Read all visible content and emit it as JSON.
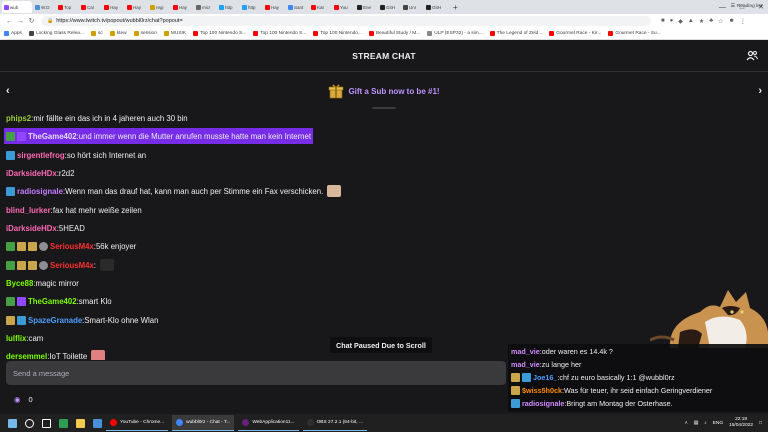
{
  "browser": {
    "tabs": [
      {
        "label": "wub",
        "color": "#9147ff",
        "active": true
      },
      {
        "label": "W.D",
        "color": "#4a90d9"
      },
      {
        "label": "Top",
        "color": "#ff0000"
      },
      {
        "label": "Cal",
        "color": "#ff0000"
      },
      {
        "label": "Hay",
        "color": "#ff0000"
      },
      {
        "label": "Hay",
        "color": "#ff0000"
      },
      {
        "label": "regi",
        "color": "#d0a000"
      },
      {
        "label": "Hay",
        "color": "#ff0000"
      },
      {
        "label": "micr",
        "color": "#666666"
      },
      {
        "label": "http",
        "color": "#1da1f2"
      },
      {
        "label": "http",
        "color": "#1da1f2"
      },
      {
        "label": "Hay",
        "color": "#ff0000"
      },
      {
        "label": "Sant",
        "color": "#4285f4"
      },
      {
        "label": "Kat",
        "color": "#ff0000"
      },
      {
        "label": "You",
        "color": "#ff0000"
      },
      {
        "label": "Ene",
        "color": "#222222"
      },
      {
        "label": "GitH",
        "color": "#222222"
      },
      {
        "label": "Unr",
        "color": "#444444"
      },
      {
        "label": "GitH",
        "color": "#222222"
      }
    ],
    "new_tab": "+",
    "url": "https://www.twitch.tv/popout/wubbl0rz/chat?popout=",
    "bookmarks": [
      {
        "label": "Apps",
        "color": "#4285f4"
      },
      {
        "label": "Locking Glass Relea...",
        "color": "#444"
      },
      {
        "label": "sc",
        "color": "#d0a000"
      },
      {
        "label": "ktew",
        "color": "#d0a000"
      },
      {
        "label": "session",
        "color": "#d0a000"
      },
      {
        "label": "MUSIK",
        "color": "#d0a000"
      },
      {
        "label": "Top 100 Nintendo S...",
        "color": "#ff0000"
      },
      {
        "label": "Top 100 Nintendo S...",
        "color": "#ff0000"
      },
      {
        "label": "Top 100 Nintendo...",
        "color": "#ff0000"
      },
      {
        "label": "Beautiful Study / M...",
        "color": "#ff0000"
      },
      {
        "label": "ULP (ESP32) - a sim...",
        "color": "#888"
      },
      {
        "label": "The Legend of Zeld...",
        "color": "#ff0000"
      },
      {
        "label": "Gourmet Race - Kir...",
        "color": "#ff0000"
      },
      {
        "label": "Gourmet Race - Su...",
        "color": "#ff0000"
      }
    ],
    "reading_list": "Reading list"
  },
  "chat": {
    "title": "STREAM CHAT",
    "sub_banner": "Gift a Sub now to be #1!",
    "messages": [
      {
        "badges": [],
        "user": "phips2",
        "color": "#9acd32",
        "text": "mir fällte ein das ich in 4 jaheren auch 30 bin"
      },
      {
        "badges": [
          "b-green",
          "b-prime"
        ],
        "user": "TheGame402",
        "color": "#e6dcff",
        "text": "und immer wenn die Mutter anrufen musste hatte man kein Internet",
        "highlight": true
      },
      {
        "badges": [
          "b-crown"
        ],
        "user": "sirgentlefrog",
        "color": "#ff69b4",
        "text": "so hört sich Internet an"
      },
      {
        "badges": [],
        "user": "iDarksideHDx",
        "color": "#ff69b4",
        "text": "r2d2"
      },
      {
        "badges": [
          "b-crown"
        ],
        "user": "radiosignale",
        "color": "#c77dff",
        "text": "Wenn man das drauf hat, kann man auch per Stimme ein Fax verschicken.",
        "emote": "#d8b89a"
      },
      {
        "badges": [],
        "user": "blind_lurker",
        "color": "#ff69b4",
        "text": "fax hat mehr weiße zeilen"
      },
      {
        "badges": [],
        "user": "iDarksideHDx",
        "color": "#ff69b4",
        "text": "5HEAD"
      },
      {
        "badges": [
          "b-green",
          "b-gold",
          "b-gold",
          "b-grey"
        ],
        "user": "SeriousM4x",
        "color": "#ff3030",
        "text": "56k enjoyer"
      },
      {
        "badges": [
          "b-green",
          "b-gold",
          "b-gold",
          "b-grey"
        ],
        "user": "SeriousM4x",
        "color": "#ff3030",
        "text": "",
        "emote": "#2a2a2a"
      },
      {
        "badges": [],
        "user": "Byce88",
        "color": "#7cfc00",
        "text": "magic mirror"
      },
      {
        "badges": [
          "b-green",
          "b-prime"
        ],
        "user": "TheGame402",
        "color": "#7cfc00",
        "text": "smart Klo"
      },
      {
        "badges": [
          "b-gold",
          "b-crown"
        ],
        "user": "SpazeGranade",
        "color": "#4d9fff",
        "text": "Smart-Klo ohne Wlan"
      },
      {
        "badges": [],
        "user": "lulflix",
        "color": "#7cfc00",
        "text": "cam"
      },
      {
        "badges": [],
        "user": "dersemmel",
        "color": "#7cfc00",
        "text": "IoT Toilette",
        "emote": "#e08080"
      }
    ],
    "paused": "Chat Paused Due to Scroll",
    "input_placeholder": "Send a message",
    "points": "0"
  },
  "overlay": {
    "lines": [
      {
        "badges": [],
        "user": "mad_vie",
        "color": "#d08cff",
        "text": "oder waren es 14.4k ?"
      },
      {
        "badges": [],
        "user": "mad_vie",
        "color": "#d08cff",
        "text": "zu lange her"
      },
      {
        "badges": [
          "b-gold",
          "b-crown"
        ],
        "user": "Joe16_",
        "color": "#4d9fff",
        "text": "chf zu euro basically 1:1 @wubbl0rz"
      },
      {
        "badges": [
          "b-gold"
        ],
        "user": "$wiss5h0ck",
        "color": "#ff8c00",
        "text": "Was für teuer, ihr seid einfach Geringverdiener"
      },
      {
        "badges": [
          "b-crown"
        ],
        "user": "radiosignale",
        "color": "#d08cff",
        "text": "Bringt am Montag der Osterhase."
      }
    ]
  },
  "taskbar": {
    "apps": [
      {
        "label": "YouTube - Chrome...",
        "color": "#ff0000"
      },
      {
        "label": "wubbl0rz - Chat - T...",
        "color": "#4285f4",
        "active": true
      },
      {
        "label": "WebApplication11...",
        "color": "#68217a"
      },
      {
        "label": "OBS 27.2.1 (64-bit, ...",
        "color": "#302e31"
      }
    ],
    "lang": "ENG",
    "time": "22:19",
    "date": "15/04/2022"
  }
}
